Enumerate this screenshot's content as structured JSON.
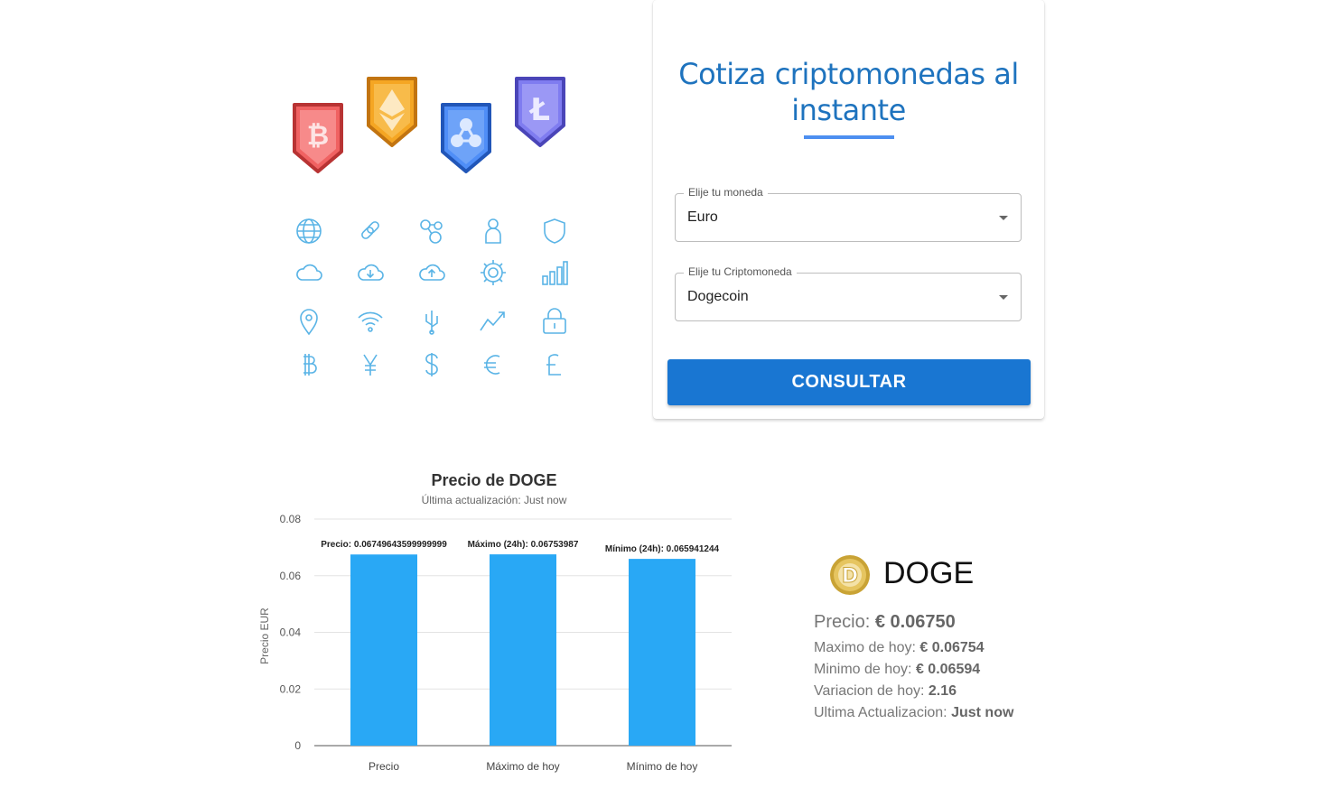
{
  "form": {
    "title": "Cotiza criptomonedas al instante",
    "currency_label": "Elije tu moneda",
    "currency_value": "Euro",
    "crypto_label": "Elije tu Criptomoneda",
    "crypto_value": "Dogecoin",
    "submit_label": "CONSULTAR"
  },
  "hero": {
    "badges": [
      "bitcoin-badge",
      "ethereum-badge",
      "ripple-badge",
      "litecoin-badge"
    ],
    "icons": [
      "globe-icon",
      "link-icon",
      "network-icon",
      "user-icon",
      "shield-icon",
      "cloud-icon",
      "cloud-download-icon",
      "cloud-upload-icon",
      "gear-icon",
      "bar-chart-icon",
      "location-pin-icon",
      "wifi-icon",
      "usb-icon",
      "trend-up-icon",
      "lock-icon",
      "bitcoin-symbol-icon",
      "yen-symbol-icon",
      "dollar-symbol-icon",
      "euro-symbol-icon",
      "litecoin-symbol-icon"
    ]
  },
  "chart_data": {
    "type": "bar",
    "title": "Precio de DOGE",
    "subtitle": "Última actualización: Just now",
    "ylabel": "Precio EUR",
    "xlabel": "",
    "categories": [
      "Precio",
      "Máximo de hoy",
      "Mínimo de hoy"
    ],
    "values": [
      0.06749643599999999,
      0.06753987,
      0.065941244
    ],
    "data_labels": [
      "Precio: 0.06749643599999999",
      "Máximo (24h): 0.06753987",
      "Mínimo (24h): 0.065941244"
    ],
    "yticks": [
      "0",
      "0.02",
      "0.04",
      "0.06",
      "0.08"
    ],
    "ylim": [
      0,
      0.08
    ],
    "grid": true,
    "color": "#29a8f5"
  },
  "result": {
    "symbol": "DOGE",
    "price_label": "Precio:",
    "price_value": "€ 0.06750",
    "high_label": "Maximo de hoy:",
    "high_value": "€ 0.06754",
    "low_label": "Minimo de hoy:",
    "low_value": "€ 0.06594",
    "change_label": "Variacion de hoy:",
    "change_value": "2.16",
    "updated_label": "Ultima Actualizacion:",
    "updated_value": "Just now"
  },
  "colors": {
    "accent": "#1e73be",
    "button": "#1976d2",
    "icon_line": "#5ab4e6"
  }
}
